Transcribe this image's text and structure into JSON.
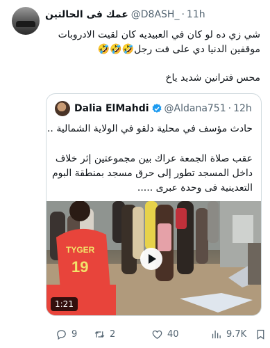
{
  "post": {
    "display_name": "عمك فى الحالتين",
    "handle": "@D8ASH_",
    "time": "11h",
    "text_line1": "شي زي ده لو كان في العبيديه كان لقيت الادروبات",
    "text_line2": "موقفين الدنيا دي على فت رجل🤣🤣🤣",
    "text_line3": "محس فترانين شديد ياخ"
  },
  "quote": {
    "display_name": "Dalia ElMahdi",
    "handle": "@Aldana751",
    "time": "12h",
    "line1": "حادث مؤسف في محلية دلقو في الولاية الشمالية ..",
    "line2": "عقب صلاة الجمعة عراك بين مجموعتين إثر خلاف",
    "line3": "داخل المسجد تطور إلى حرق مسجد بمنطقة البوم",
    "line4": "التعدينية فى وحدة عبرى .....",
    "video_duration": "1:21",
    "jersey_text": "TYGER",
    "jersey_number": "19"
  },
  "actions": {
    "replies": "9",
    "retweets": "2",
    "likes": "40",
    "views": "9.7K"
  },
  "colors": {
    "text": "#0f1419",
    "secondary": "#536471",
    "border": "#cfd9de",
    "verified": "#1d9bf0"
  }
}
